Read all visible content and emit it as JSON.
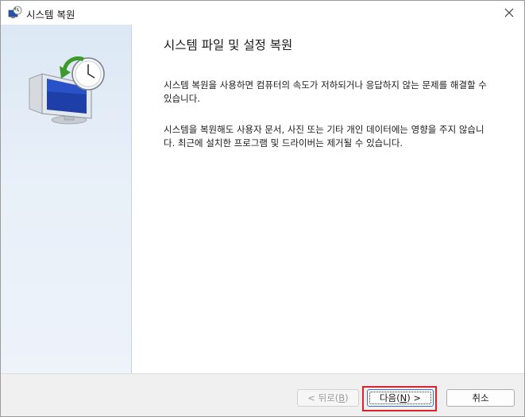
{
  "window": {
    "title": "시스템 복원",
    "icon": "system-restore-icon",
    "close_icon": "close-icon"
  },
  "content": {
    "heading": "시스템 파일 및 설정 복원",
    "paragraph1": "시스템 복원을 사용하면 컴퓨터의 속도가 저하되거나 응답하지 않는 문제를 해결할 수 있습니다.",
    "paragraph2": "시스템을 복원해도 사용자 문서, 사진 또는 기타 개인 데이터에는 영향을 주지 않습니다. 최근에 설치한 프로그램 및 드라이버는 제거될 수 있습니다."
  },
  "buttons": {
    "back": {
      "label_prefix": "< 뒤로(",
      "mnemonic": "B",
      "label_suffix": ")",
      "enabled": false
    },
    "next": {
      "label_prefix": "다음(",
      "mnemonic": "N",
      "label_suffix": ") >",
      "focused": true
    },
    "cancel": {
      "label": "취소"
    }
  },
  "colors": {
    "focus_highlight": "#e0202a",
    "side_pane": "#dce8f5"
  }
}
